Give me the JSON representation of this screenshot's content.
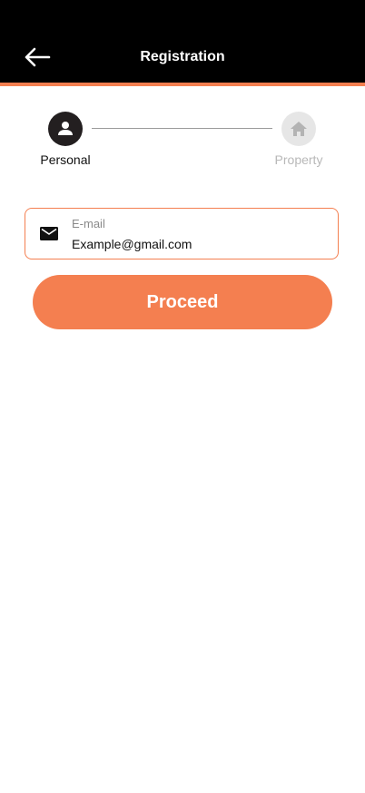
{
  "header": {
    "title": "Registration",
    "back_icon": "arrow-left-icon",
    "background": "#000000",
    "accent_color": "#F47F50"
  },
  "stepper": {
    "steps": [
      {
        "label": "Personal",
        "icon": "person-icon",
        "state": "active"
      },
      {
        "label": "Property",
        "icon": "home-icon",
        "state": "inactive"
      }
    ]
  },
  "email_field": {
    "label": "E-mail",
    "value": "Example@gmail.com",
    "icon": "mail-icon"
  },
  "proceed_button": {
    "label": "Proceed",
    "color": "#F47F50"
  }
}
